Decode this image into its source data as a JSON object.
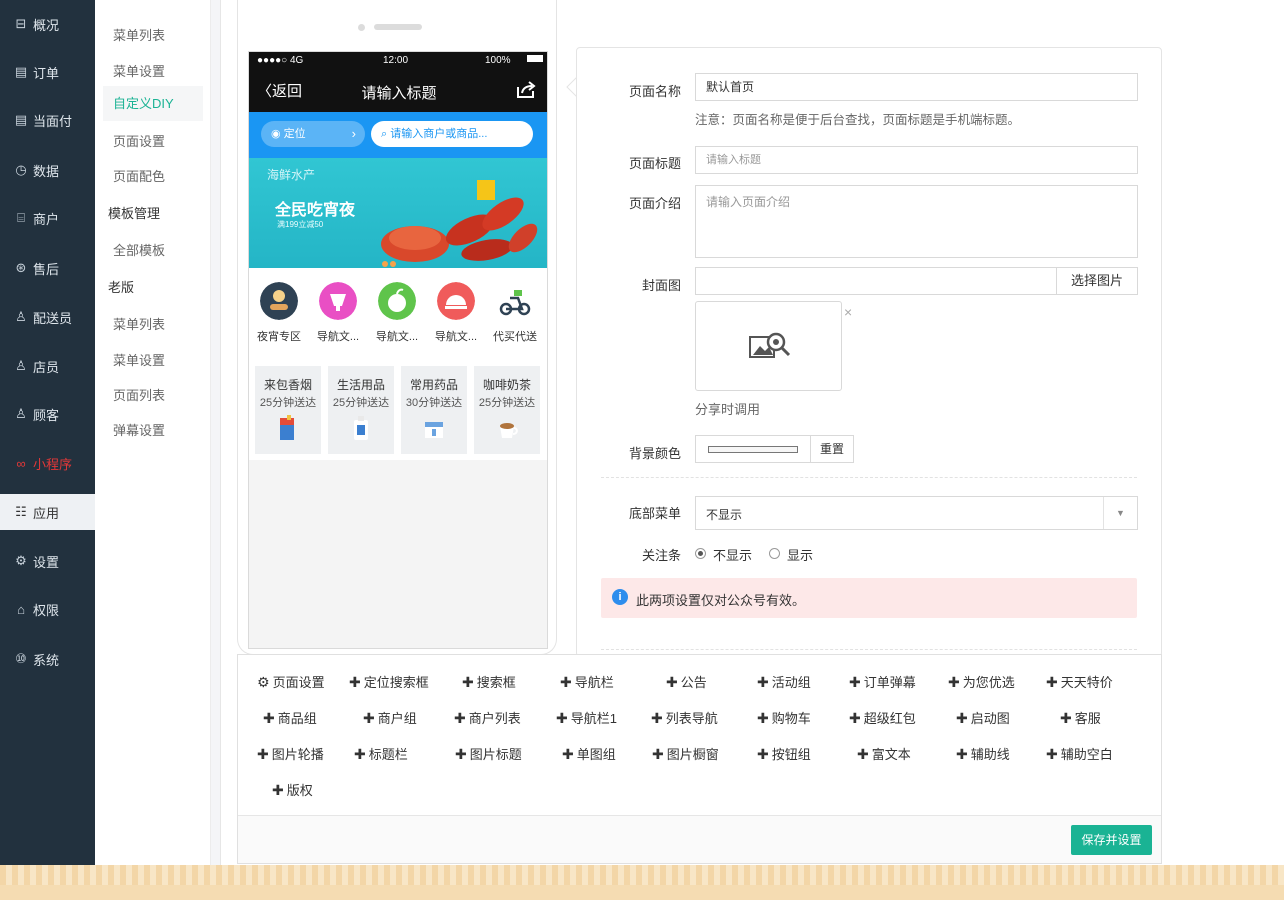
{
  "main_nav": {
    "items": [
      {
        "label": "概况",
        "icon": "overview-icon"
      },
      {
        "label": "订单",
        "icon": "order-icon"
      },
      {
        "label": "当面付",
        "icon": "pay-icon"
      },
      {
        "label": "数据",
        "icon": "data-icon"
      },
      {
        "label": "商户",
        "icon": "merchant-icon"
      },
      {
        "label": "售后",
        "icon": "after-sale-icon"
      },
      {
        "label": "配送员",
        "icon": "courier-icon"
      },
      {
        "label": "店员",
        "icon": "clerk-icon"
      },
      {
        "label": "顾客",
        "icon": "customer-icon"
      },
      {
        "label": "小程序",
        "icon": "mini-program-icon"
      },
      {
        "label": "应用",
        "icon": "apps-icon"
      },
      {
        "label": "设置",
        "icon": "gear-icon"
      },
      {
        "label": "权限",
        "icon": "lock-icon"
      },
      {
        "label": "系统",
        "icon": "system-icon"
      }
    ],
    "selected_label": "应用",
    "highlight_color": "#e23838"
  },
  "sub_nav": {
    "items": [
      "菜单列表",
      "菜单设置",
      "自定义DIY",
      "页面设置",
      "页面配色"
    ],
    "section_template": "模板管理",
    "template_items": [
      "全部模板"
    ],
    "section_old": "老版",
    "old_items": [
      "菜单列表",
      "菜单设置",
      "页面列表",
      "弹幕设置"
    ],
    "active_color": "#1ab394"
  },
  "phone": {
    "status": {
      "carrier": "●●●●○ 4G",
      "time": "12:00",
      "battery": "100%"
    },
    "back_label": "返回",
    "title": "请输入标题",
    "location_label": "定位",
    "search_placeholder": "请输入商户或商品...",
    "banner": {
      "category": "海鲜水产",
      "headline": "全民吃宵夜",
      "promo": "满199立减50"
    },
    "nav_icons": [
      {
        "label": "夜宵专区",
        "color": "#2f4254"
      },
      {
        "label": "导航文...",
        "color": "#e94fc4"
      },
      {
        "label": "导航文...",
        "color": "#5fc44b"
      },
      {
        "label": "导航文...",
        "color": "#f05b5b"
      },
      {
        "label": "代买代送",
        "color": "#ffffff"
      }
    ],
    "cards": [
      {
        "title": "来包香烟",
        "subtitle": "25分钟送达"
      },
      {
        "title": "生活用品",
        "subtitle": "25分钟送达"
      },
      {
        "title": "常用药品",
        "subtitle": "30分钟送达"
      },
      {
        "title": "咖啡奶茶",
        "subtitle": "25分钟送达"
      }
    ]
  },
  "form": {
    "page_name_label": "页面名称",
    "page_name_value": "默认首页",
    "page_name_note": "注意：页面名称是便于后台查找，页面标题是手机端标题。",
    "page_title_label": "页面标题",
    "page_title_placeholder": "请输入标题",
    "page_intro_label": "页面介绍",
    "page_intro_placeholder": "请输入页面介绍",
    "cover_label": "封面图",
    "cover_button": "选择图片",
    "cover_close": "×",
    "cover_hint": "分享时调用",
    "bg_color_label": "背景颜色",
    "reset_button": "重置",
    "bottom_menu_label": "底部菜单",
    "bottom_menu_value": "不显示",
    "follow_label": "关注条",
    "follow_options": [
      "不显示",
      "显示"
    ],
    "follow_selected": "不显示",
    "notice_text": "此两项设置仅对公众号有效。"
  },
  "components": {
    "items": [
      "页面设置",
      "定位搜索框",
      "搜索框",
      "导航栏",
      "公告",
      "活动组",
      "订单弹幕",
      "为您优选",
      "天天特价",
      "商品组",
      "商户组",
      "商户列表",
      "导航栏1",
      "列表导航",
      "购物车",
      "超级红包",
      "启动图",
      "客服",
      "图片轮播",
      "标题栏",
      "图片标题",
      "单图组",
      "图片橱窗",
      "按钮组",
      "富文本",
      "辅助线",
      "辅助空白",
      "版权"
    ],
    "save_button": "保存并设置"
  }
}
